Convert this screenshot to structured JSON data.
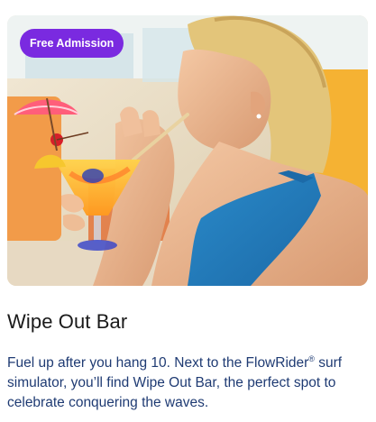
{
  "card": {
    "badge": "Free Admission",
    "title": "Wipe Out Bar",
    "description_part1": "Fuel up after you hang 10. Next to the FlowRider",
    "registered_mark": "®",
    "description_part2": " surf simulator, you’ll find Wipe Out Bar, the perfect spot to celebrate conquering the waves."
  },
  "colors": {
    "badge_bg": "#7a2ae0",
    "title": "#1a1a1a",
    "description": "#1f3b73"
  }
}
